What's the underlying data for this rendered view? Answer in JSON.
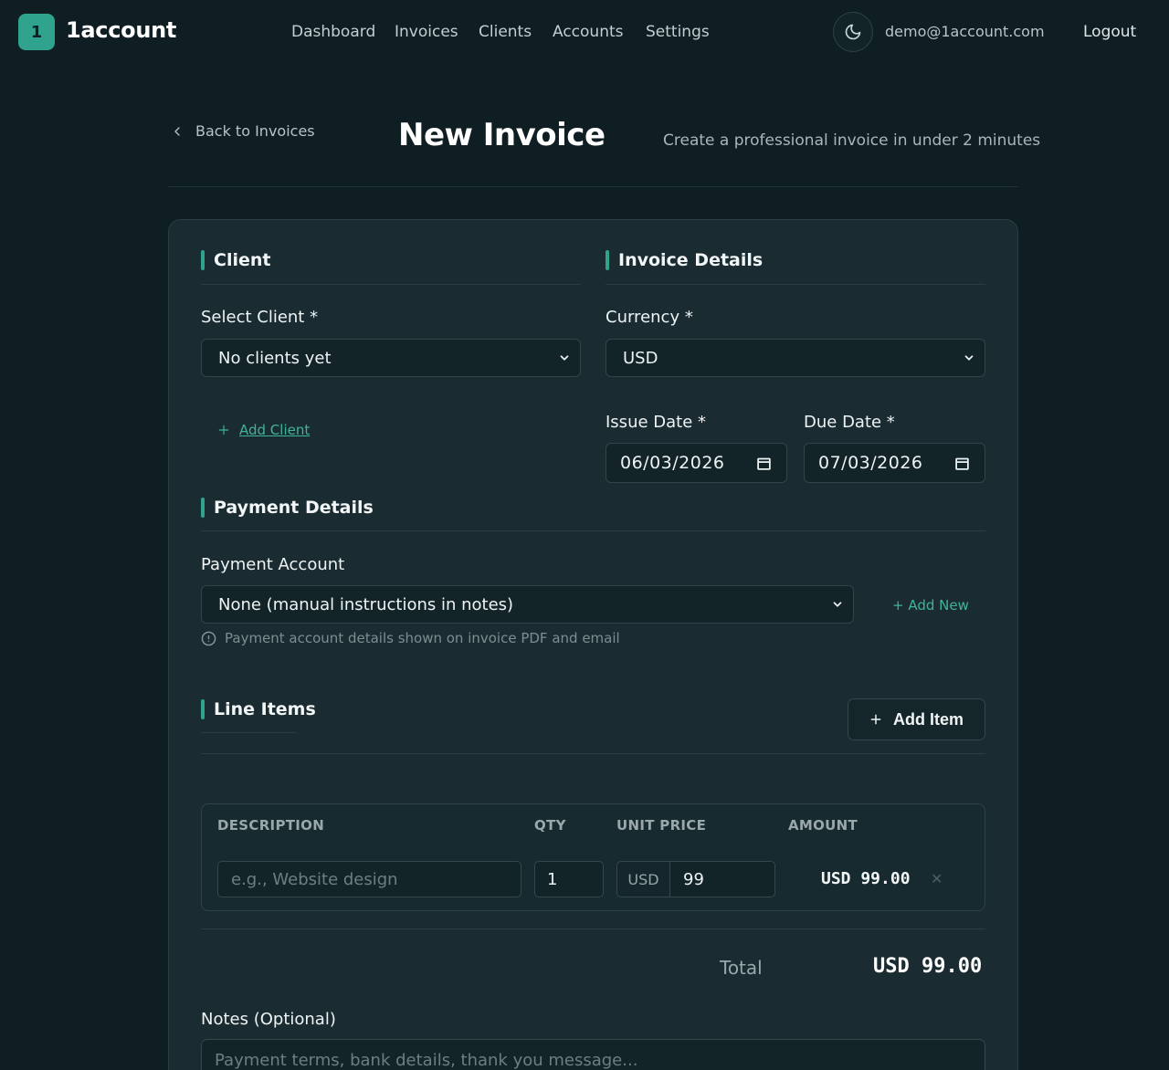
{
  "brand": {
    "badge": "1",
    "name": "1account",
    "accent": "#2fa38d"
  },
  "nav": {
    "links": [
      "Dashboard",
      "Invoices",
      "Clients",
      "Accounts",
      "Settings"
    ],
    "user_email": "demo@1account.com",
    "logout": "Logout"
  },
  "header": {
    "back_label": "Back to Invoices",
    "title": "New Invoice",
    "subtitle": "Create a professional invoice in under 2 minutes"
  },
  "client_section": {
    "title": "Client",
    "select_label": "Select Client *",
    "select_value": "No clients yet",
    "add_client": "Add Client"
  },
  "invoice_details": {
    "title": "Invoice Details",
    "currency_label": "Currency *",
    "currency_value": "USD",
    "issue_date_label": "Issue Date *",
    "issue_date": "06/03/2026",
    "due_date_label": "Due Date *",
    "due_date": "07/03/2026"
  },
  "payment": {
    "title": "Payment Details",
    "account_label": "Payment Account",
    "account_value": "None (manual instructions in notes)",
    "add_new": "+ Add New",
    "hint": "Payment account details shown on invoice PDF and email"
  },
  "line_items": {
    "title": "Line Items",
    "add_item": "Add Item",
    "columns": [
      "DESCRIPTION",
      "QTY",
      "UNIT PRICE",
      "AMOUNT"
    ],
    "rows": [
      {
        "description_placeholder": "e.g., Website design",
        "qty": "1",
        "currency": "USD",
        "unit_price": "99",
        "amount": "USD 99.00"
      }
    ]
  },
  "total": {
    "label": "Total",
    "value": "USD 99.00"
  },
  "notes": {
    "label": "Notes (Optional)",
    "placeholder": "Payment terms, bank details, thank you message..."
  }
}
